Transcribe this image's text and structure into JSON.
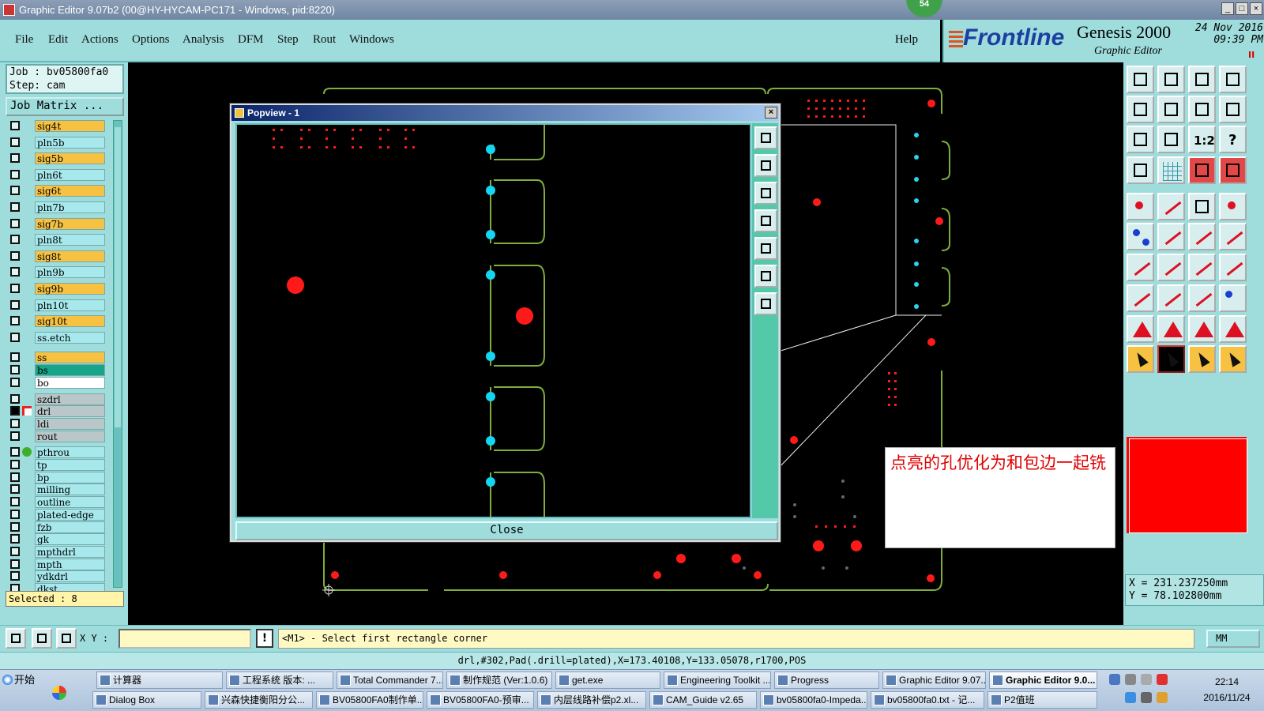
{
  "window": {
    "title": "Graphic Editor 9.07b2 (00@HY-HYCAM-PC171 - Windows, pid:8220)",
    "badge": "54",
    "controls": [
      "_",
      "□",
      "×"
    ]
  },
  "menu": {
    "items": [
      "File",
      "Edit",
      "Actions",
      "Options",
      "Analysis",
      "DFM",
      "Step",
      "Rout",
      "Windows"
    ],
    "help": "Help"
  },
  "brand": {
    "logo": "Frontline",
    "product": "Genesis 2000",
    "subtitle": "Graphic Editor",
    "date": "24 Nov 2016",
    "time": "09:39 PM",
    "record_mark": "II",
    "brand_color": "#1c3fa0"
  },
  "job": {
    "job_line": "Job : bv05800fa0",
    "step_line": "Step: cam",
    "matrix_button": "Job Matrix ...",
    "selected": "Selected : 8"
  },
  "layers": [
    {
      "name": "sig4t",
      "type": "sig",
      "checked": false
    },
    {
      "name": "pln5b",
      "type": "pln",
      "checked": false
    },
    {
      "name": "sig5b",
      "type": "sig",
      "checked": false
    },
    {
      "name": "pln6t",
      "type": "pln",
      "checked": false
    },
    {
      "name": "sig6t",
      "type": "sig",
      "checked": false
    },
    {
      "name": "pln7b",
      "type": "pln",
      "checked": false
    },
    {
      "name": "sig7b",
      "type": "sig",
      "checked": false
    },
    {
      "name": "pln8t",
      "type": "pln",
      "checked": false
    },
    {
      "name": "sig8t",
      "type": "sig",
      "checked": false
    },
    {
      "name": "pln9b",
      "type": "pln",
      "checked": false
    },
    {
      "name": "sig9b",
      "type": "sig",
      "checked": false
    },
    {
      "name": "pln10t",
      "type": "pln",
      "checked": false
    },
    {
      "name": "sig10t",
      "type": "sig",
      "checked": false
    },
    {
      "name": "ss.etch",
      "type": "etch",
      "checked": false
    },
    {
      "name": "ss",
      "type": "ss",
      "checked": false
    },
    {
      "name": "bs",
      "type": "bs",
      "checked": false
    },
    {
      "name": "bo",
      "type": "bo",
      "checked": false
    },
    {
      "name": "szdrl",
      "type": "drl",
      "checked": false
    },
    {
      "name": "drl",
      "type": "drl",
      "checked": true,
      "marker": "arrow-icon"
    },
    {
      "name": "ldi",
      "type": "drl",
      "checked": false
    },
    {
      "name": "rout",
      "type": "drl",
      "checked": false
    },
    {
      "name": "pthrou",
      "type": "misc",
      "checked": false,
      "marker": "green-dot-icon"
    },
    {
      "name": "tp",
      "type": "misc",
      "checked": false
    },
    {
      "name": "bp",
      "type": "misc",
      "checked": false
    },
    {
      "name": "milling",
      "type": "misc",
      "checked": false
    },
    {
      "name": "outline",
      "type": "misc",
      "checked": false
    },
    {
      "name": "plated-edge",
      "type": "misc",
      "checked": false
    },
    {
      "name": "fzb",
      "type": "misc",
      "checked": false
    },
    {
      "name": "gk",
      "type": "misc",
      "checked": false
    },
    {
      "name": "mpthdrl",
      "type": "misc",
      "checked": false
    },
    {
      "name": "mpth",
      "type": "misc",
      "checked": false
    },
    {
      "name": "ydkdrl",
      "type": "misc",
      "checked": false
    },
    {
      "name": "dkst",
      "type": "misc",
      "checked": false
    }
  ],
  "popview": {
    "title": "Popview - 1",
    "close_label": "Close",
    "close_x": "×"
  },
  "annotation": {
    "text": "点亮的孔优化为和包边一起铣",
    "color": "#e00000"
  },
  "coordinates": {
    "x_line": "X = 231.237250mm",
    "y_line": "Y = 78.102800mm"
  },
  "command": {
    "xy_label": "X Y :",
    "xy_value": "",
    "excl": "!",
    "prompt": "<M1> - Select first rectangle corner",
    "units": "MM"
  },
  "status_line": "drl,#302,Pad(.drill=plated),X=173.40108,Y=133.05078,r1700,POS",
  "toolbox": {
    "rows": [
      [
        "zoom-in-icon",
        "zoom-out-icon",
        "home-icon",
        "fit-icon"
      ],
      [
        "pan-left-icon",
        "pan-right-icon",
        "pan-both-icon",
        "redraw-icon"
      ],
      [
        "zoom-area-icon",
        "zoom-center-icon",
        "ratio-icon",
        "help-icon"
      ],
      [
        "settings-icon",
        "grid-icon",
        "layers-red-icon",
        "layers-red2-icon"
      ],
      [
        "pad-icon",
        "rect-icon",
        "ruler-icon",
        "circle-icon"
      ],
      [
        "connect-icon",
        "cross-icon",
        "line-icon",
        "line-arrow-icon"
      ],
      [
        "angle-icon",
        "slash-icon",
        "arc-icon",
        "pins-icon"
      ],
      [
        "point-icon",
        "minus-icon",
        "box-icon",
        "blue-shape-icon"
      ],
      [
        "measure-icon",
        "text-icon",
        "font-icon",
        "curve-icon"
      ],
      [
        "pointer-icon",
        "select-icon",
        "select2-icon",
        "multi-icon"
      ]
    ],
    "ratio_label": "1:2",
    "help_label": "?"
  },
  "taskbar": {
    "start": "开始",
    "row1": [
      {
        "label": "计算器",
        "active": false
      },
      {
        "label": "工程系统  版本: ...",
        "active": false
      },
      {
        "label": "Total Commander 7...",
        "active": false
      },
      {
        "label": "制作规范 (Ver:1.0.6)",
        "active": false
      },
      {
        "label": "get.exe",
        "active": false
      },
      {
        "label": "Engineering Toolkit ...",
        "active": false
      },
      {
        "label": "Progress",
        "active": false
      },
      {
        "label": "Graphic Editor 9.07...",
        "active": false
      },
      {
        "label": "Graphic Editor 9.0...",
        "active": true
      }
    ],
    "row2": [
      {
        "label": "Dialog Box",
        "active": false
      },
      {
        "label": "兴森快捷衡阳分公...",
        "active": false
      },
      {
        "label": "BV05800FA0制作单...",
        "active": false
      },
      {
        "label": "BV05800FA0-预审...",
        "active": false
      },
      {
        "label": "内层线路补偿p2.xl...",
        "active": false
      },
      {
        "label": "CAM_Guide v2.65",
        "active": false
      },
      {
        "label": "bv05800fa0-Impeda...",
        "active": false
      },
      {
        "label": "bv05800fa0.txt - 记...",
        "active": false
      },
      {
        "label": "P2值班",
        "active": false
      }
    ],
    "clock_time": "22:14",
    "clock_date": "2016/11/24"
  }
}
